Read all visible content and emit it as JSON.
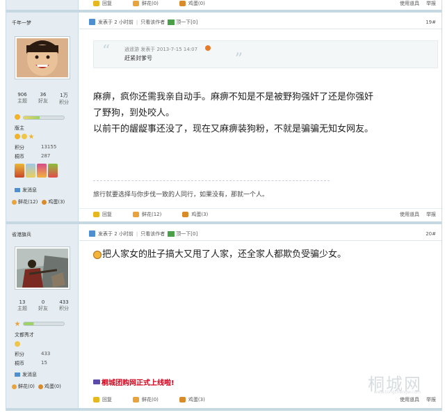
{
  "top_bar": {
    "reply": "回复",
    "flower": "鲜花(0)",
    "egg": "鸡蛋(0)",
    "use_item": "使用道具",
    "report": "举报"
  },
  "posts": [
    {
      "username": "千年一梦",
      "stats": [
        {
          "value": "906",
          "label": "主题"
        },
        {
          "value": "36",
          "label": "好友"
        },
        {
          "value": "1万",
          "label": "积分"
        }
      ],
      "rank": "版主",
      "points_label": "积分",
      "points": "13155",
      "coin_label": "桐币",
      "coins": "287",
      "send_msg": "发消息",
      "flower": "鲜花(12)",
      "egg": "鸡蛋(3)",
      "posted": "发表于 2 小时前",
      "only_author": "只看该作者",
      "bump": "顶一下[0]",
      "floor": "19#",
      "quote_meta": "逍遥游 发表于 2013-7-15 14:07",
      "quote_text": "赶紧封爹号",
      "body_lines": [
        "麻痹，疯你还需我亲自动手。麻痹不知是不是被野狗强奸了还是你强奸",
        "了野狗，到处咬人。",
        "以前干的龌龊事还没了，现在又麻痹装狗粉，不就是骗骗无知女网友。"
      ],
      "signature": "旅行就要选择与你步伐一致的人同行，如果没有，那就一个人。",
      "actions": {
        "reply": "回复",
        "flower": "鲜花(12)",
        "egg": "鸡蛋(3)",
        "use_item": "使用道具",
        "report": "举报"
      }
    },
    {
      "username": "省港旗兵",
      "stats": [
        {
          "value": "13",
          "label": "主题"
        },
        {
          "value": "0",
          "label": "好友"
        },
        {
          "value": "433",
          "label": "积分"
        }
      ],
      "rank": "文都秀才",
      "points_label": "积分",
      "points": "433",
      "coin_label": "桐币",
      "coins": "15",
      "send_msg": "发消息",
      "flower": "鲜花(0)",
      "egg": "鸡蛋(0)",
      "posted": "发表于 2 小时前",
      "only_author": "只看该作者",
      "bump": "顶一下[0]",
      "floor": "20#",
      "body_lines": [
        "把人家女的肚子搞大又甩了人家，还全家人都欺负受骗少女。"
      ],
      "ad": "桐城团购网正式上线啦!",
      "actions": {
        "reply": "回复",
        "flower": "鲜花(0)",
        "egg": "鸡蛋(3)",
        "use_item": "使用道具",
        "report": "举报"
      }
    }
  ],
  "watermark": {
    "name": "桐城网",
    "url": "www.tongchengw.com"
  }
}
